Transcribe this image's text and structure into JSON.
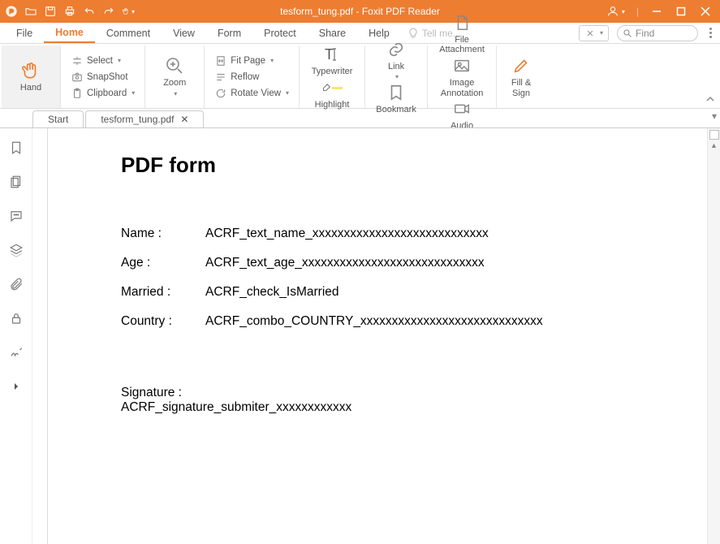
{
  "titlebar": {
    "title": "tesform_tung.pdf - Foxit PDF Reader"
  },
  "menu": {
    "file": "File",
    "home": "Home",
    "comment": "Comment",
    "view": "View",
    "form": "Form",
    "protect": "Protect",
    "share": "Share",
    "help": "Help",
    "tellme": "Tell me...",
    "find": "Find"
  },
  "ribbon": {
    "hand": "Hand",
    "select": "Select",
    "snapshot": "SnapShot",
    "clipboard": "Clipboard",
    "zoom": "Zoom",
    "fitpage": "Fit Page",
    "reflow": "Reflow",
    "rotateview": "Rotate View",
    "typewriter": "Typewriter",
    "highlight": "Highlight",
    "link": "Link",
    "bookmark": "Bookmark",
    "fileattach": "File\nAttachment",
    "imageanno": "Image\nAnnotation",
    "audiovideo": "Audio\n& Video",
    "fillsign": "Fill &\nSign"
  },
  "tabs": {
    "start": "Start",
    "doc": "tesform_tung.pdf"
  },
  "doc": {
    "heading": "PDF form",
    "rows": [
      {
        "label": "Name :",
        "value": "ACRF_text_name_xxxxxxxxxxxxxxxxxxxxxxxxxxxx"
      },
      {
        "label": "Age :",
        "value": "ACRF_text_age_xxxxxxxxxxxxxxxxxxxxxxxxxxxxx"
      },
      {
        "label": "Married :",
        "value": "ACRF_check_IsMarried"
      },
      {
        "label": "Country :",
        "value": "ACRF_combo_COUNTRY_xxxxxxxxxxxxxxxxxxxxxxxxxxxxx"
      }
    ],
    "sig_label": "Signature :",
    "sig_value": "ACRF_signature_submiter_xxxxxxxxxxxx"
  }
}
